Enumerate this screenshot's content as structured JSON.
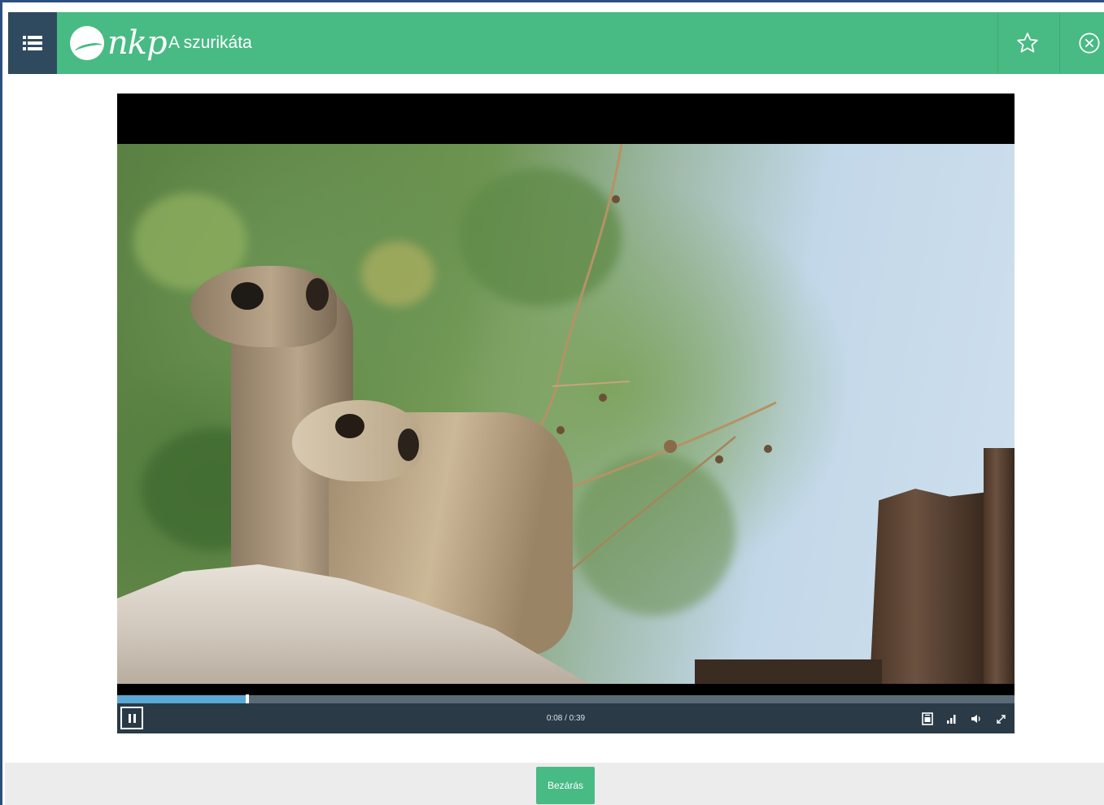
{
  "header": {
    "menu_icon": "list-icon",
    "logo_text": "nkp",
    "title": "A szurikáta",
    "favorite_icon": "star-outline-icon",
    "close_icon": "circle-x-icon"
  },
  "player": {
    "current_time": "0:08",
    "duration": "0:39",
    "time_display": "0:08 / 0:39",
    "progress": 0.145,
    "controls": {
      "play_state_icon": "pause-icon",
      "subtitles_icon": "cc-icon",
      "quality_icon": "signal-bars-icon",
      "volume_icon": "volume-icon",
      "fullscreen_icon": "expand-icon"
    }
  },
  "footer": {
    "close_label": "Bezárás"
  },
  "colors": {
    "header_green": "#48ba84",
    "menu_dark": "#2f4a5e",
    "frame_border": "#2b4f7e",
    "progress_blue": "#5aa8d6",
    "controls_bg": "#2a3a47",
    "footer_bg": "#ececec"
  }
}
